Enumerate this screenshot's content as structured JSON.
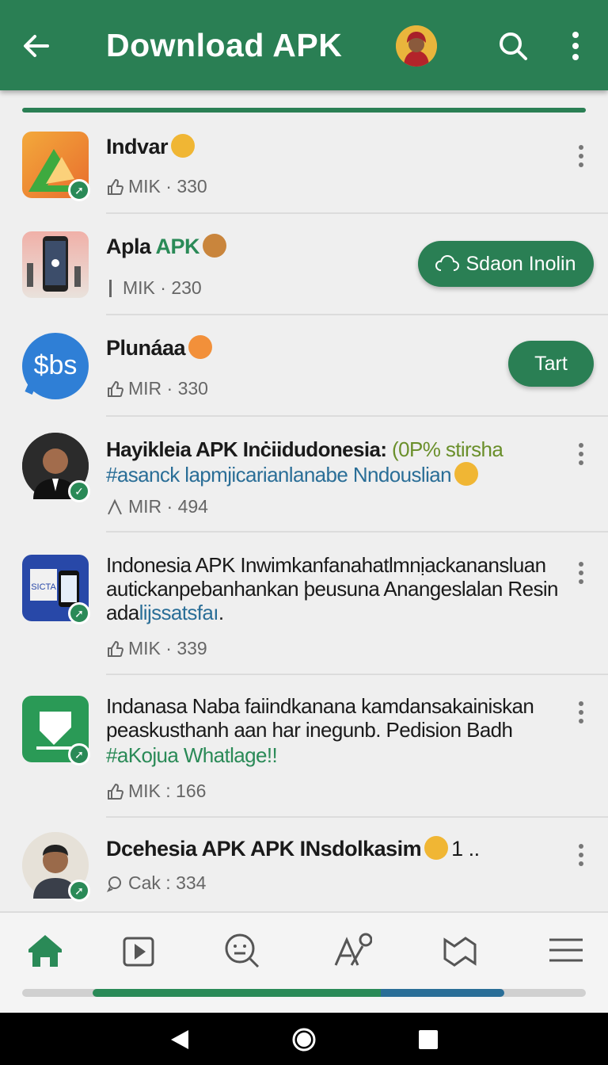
{
  "appbar": {
    "title": "Download APK",
    "icons": [
      "back-arrow-icon",
      "user-avatar",
      "search-icon",
      "more-vert-icon"
    ],
    "color": "#2a7f54"
  },
  "list": [
    {
      "name": "Indvar",
      "meta": "MIK · 330",
      "action": "kebab"
    },
    {
      "name_a": "Apla ",
      "name_b": "APK",
      "meta": "MIK · 230",
      "action_label": "Sdaon Inolin"
    },
    {
      "name": "Plunáaa",
      "meta": "MIR · 330",
      "action_label": "Tart"
    },
    {
      "line1_a": "Hayikleia APK Inċiidudonesia: ",
      "line1_b": "(0P% stirsha",
      "line2": "#asanck lapmjicarianlanabe Nndouslian",
      "meta": "MIR · 494",
      "action": "kebab"
    },
    {
      "line1": "Indonesia APK Inwimkanfanahatlmnịackanansluan",
      "line2": "autickanpebanhankan þeusuna Anangeslalan Resin",
      "line3_a": "ada",
      "line3_b": "lijssatsfaı",
      "line3_c": ".",
      "meta": "MIK · 339",
      "action": "kebab"
    },
    {
      "line1": "Indanasa Naba faiindkanana kamdansakainiskan",
      "line2": "peaskusthanh aan har inegunb. Pedision Badh",
      "line3": "#aKojua Whatlage!!",
      "meta": "MIK : 166",
      "action": "kebab"
    },
    {
      "name": "Dcehesia APK APK INsdolkasim",
      "suffix": "1 ..",
      "meta": "Cak : 334",
      "action": "kebab"
    }
  ],
  "bottom_nav": {
    "items": [
      "home-icon",
      "video-icon",
      "face-search-icon",
      "draw-icon",
      "map-icon",
      "menu-icon"
    ],
    "progress_start": 0.125,
    "progress_end": 0.855
  },
  "system_nav": [
    "back-triangle-icon",
    "home-circle-icon",
    "recents-square-icon"
  ]
}
